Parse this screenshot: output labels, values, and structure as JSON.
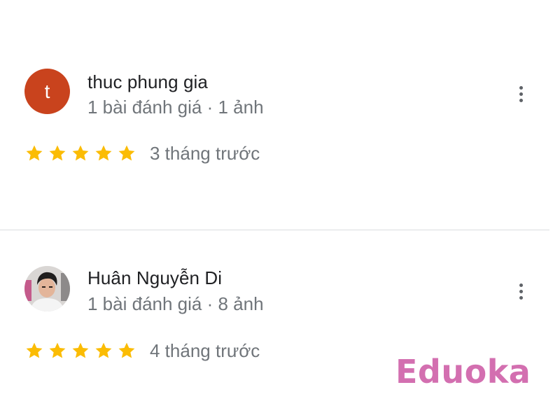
{
  "reviews": [
    {
      "author": "thuc phung gia",
      "avatar_letter": "t",
      "avatar_color": "#c9431d",
      "meta": "1 bài đánh giá · 1 ảnh",
      "rating": 5,
      "rating_max": 5,
      "time": "3 tháng trước",
      "more_icon": "more-vert-icon"
    },
    {
      "author": "Huân Nguyễn Di",
      "avatar_type": "photo",
      "meta": "1 bài đánh giá · 8 ảnh",
      "rating": 5,
      "rating_max": 5,
      "time": "4 tháng trước",
      "more_icon": "more-vert-icon"
    }
  ],
  "colors": {
    "star": "#fbbc04",
    "name_text": "#202124",
    "secondary_text": "#70757a",
    "divider": "#dadce0",
    "watermark": "#d36fb0"
  },
  "watermark": {
    "text": "Eduoka"
  }
}
